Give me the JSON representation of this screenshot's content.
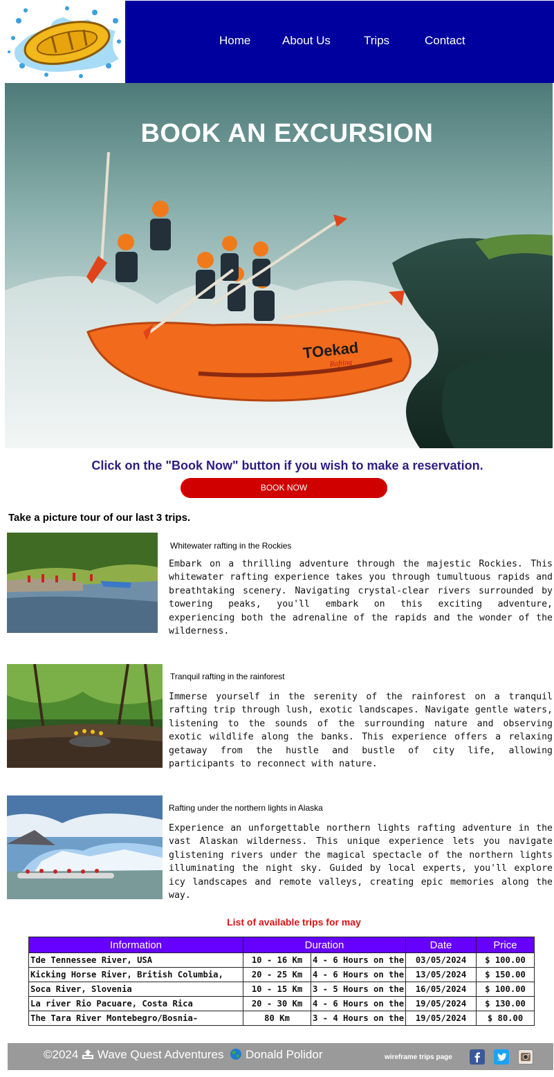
{
  "nav": {
    "items": [
      {
        "label": "Home"
      },
      {
        "label": "About Us"
      },
      {
        "label": "Trips"
      },
      {
        "label": "Contact"
      }
    ]
  },
  "hero": {
    "title": "BOOK AN EXCURSION",
    "raft_brand": "TOekad",
    "raft_brand_sub": "Rafting"
  },
  "cta": {
    "text": "Click on the \"Book Now\" button if you wish to make a reservation.",
    "button_label": "BOOK NOW"
  },
  "tour": {
    "heading": "Take a picture tour of our last 3 trips.",
    "trips": [
      {
        "title": "Whitewater rafting in the Rockies",
        "description": "Embark on a thrilling adventure through the majestic Rockies. This whitewater rafting experience takes you through tumultuous rapids and breathtaking scenery. Navigating crystal-clear rivers surrounded by towering peaks, you'll embark on this exciting adventure, experiencing both the adrenaline of the rapids and the wonder of the wilderness."
      },
      {
        "title": "Tranquil rafting in the rainforest",
        "description": "Immerse yourself in the serenity of the rainforest on a tranquil rafting trip through lush, exotic landscapes. Navigate gentle waters, listening to the sounds of the surrounding nature and observing exotic wildlife along the banks. This experience offers a relaxing getaway from the hustle and bustle of city life, allowing participants to reconnect with nature."
      },
      {
        "title": "Rafting under the northern lights in Alaska",
        "description": "Experience an unforgettable northern lights rafting adventure in the vast Alaskan wilderness. This unique experience lets you navigate glistening rivers under the magical spectacle of the northern lights illuminating the night sky. Guided by local experts, you'll explore icy landscapes and remote valleys, creating epic memories along the way."
      }
    ]
  },
  "schedule": {
    "title": "List of available trips for may",
    "headers": [
      "Information",
      "Duration",
      "Date",
      "Price"
    ],
    "rows": [
      {
        "info": "Tde Tennessee River, USA",
        "distance": "10 - 16 Km",
        "hours": "4 - 6 Hours on the",
        "date": "03/05/2024",
        "price": "$ 100.00"
      },
      {
        "info": "Kicking Horse River, British Columbia,",
        "distance": "20 - 25 Km",
        "hours": "4 - 6 Hours on the",
        "date": "13/05/2024",
        "price": "$ 150.00"
      },
      {
        "info": "Soca River, Slovenia",
        "distance": "10 - 15 Km",
        "hours": "3 - 5 Hours on the",
        "date": "16/05/2024",
        "price": "$ 100.00"
      },
      {
        "info": "La river Rio Pacuare, Costa Rica",
        "distance": "20 - 30 Km",
        "hours": "4 - 6 Hours on the",
        "date": "19/05/2024",
        "price": "$ 130.00"
      },
      {
        "info": "The Tara River Montebegro/Bosnia-",
        "distance": "80 Km",
        "hours": "3 - 4 Hours on the",
        "date": "19/05/2024",
        "price": "$ 80.00"
      }
    ]
  },
  "footer": {
    "copyright": "©2024",
    "company": "Wave Quest Adventures",
    "author": "Donald Polidor",
    "page_label": "wireframe trips page",
    "social_icons": [
      "facebook-icon",
      "twitter-icon",
      "instagram-icon"
    ]
  },
  "colors": {
    "nav_bg": "#00009e",
    "cta_text": "#2e1d80",
    "button": "#d10000",
    "table_header": "#6600ff",
    "list_title": "#dd1111",
    "footer_bg": "#9a9a9a"
  }
}
